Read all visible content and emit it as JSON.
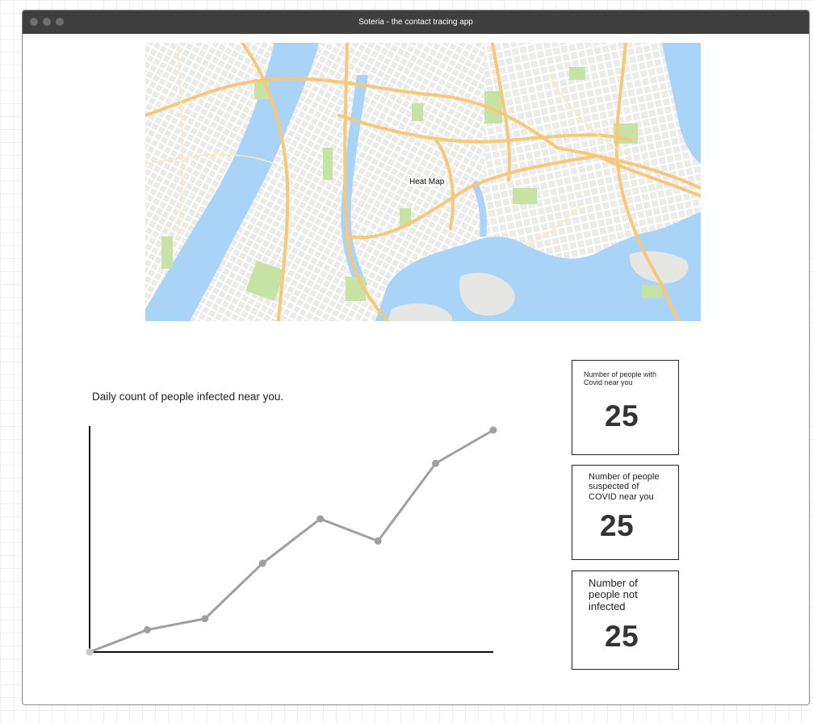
{
  "window": {
    "title": "Soteria - the contact tracing app"
  },
  "map": {
    "label": "Heat Map"
  },
  "chart": {
    "title": "Daily count of people infected near you."
  },
  "chart_data": {
    "type": "line",
    "x": [
      1,
      2,
      3,
      4,
      5,
      6,
      7,
      8
    ],
    "values": [
      0,
      4,
      6,
      16,
      24,
      20,
      34,
      40
    ],
    "ylim": [
      0,
      40
    ],
    "grid": false,
    "color": "#a0a0a0"
  },
  "cards": [
    {
      "label": "Number of people with Covid near you",
      "value": "25"
    },
    {
      "label": "Number of people suspected of COVID near you",
      "value": "25"
    },
    {
      "label": "Number of people not infected",
      "value": "25"
    }
  ],
  "colors": {
    "titlebar": "#3f3f3f",
    "water": "#aad3f8",
    "park": "#c6e3a3",
    "highway": "#f7c77a",
    "series": "#a0a0a0"
  }
}
